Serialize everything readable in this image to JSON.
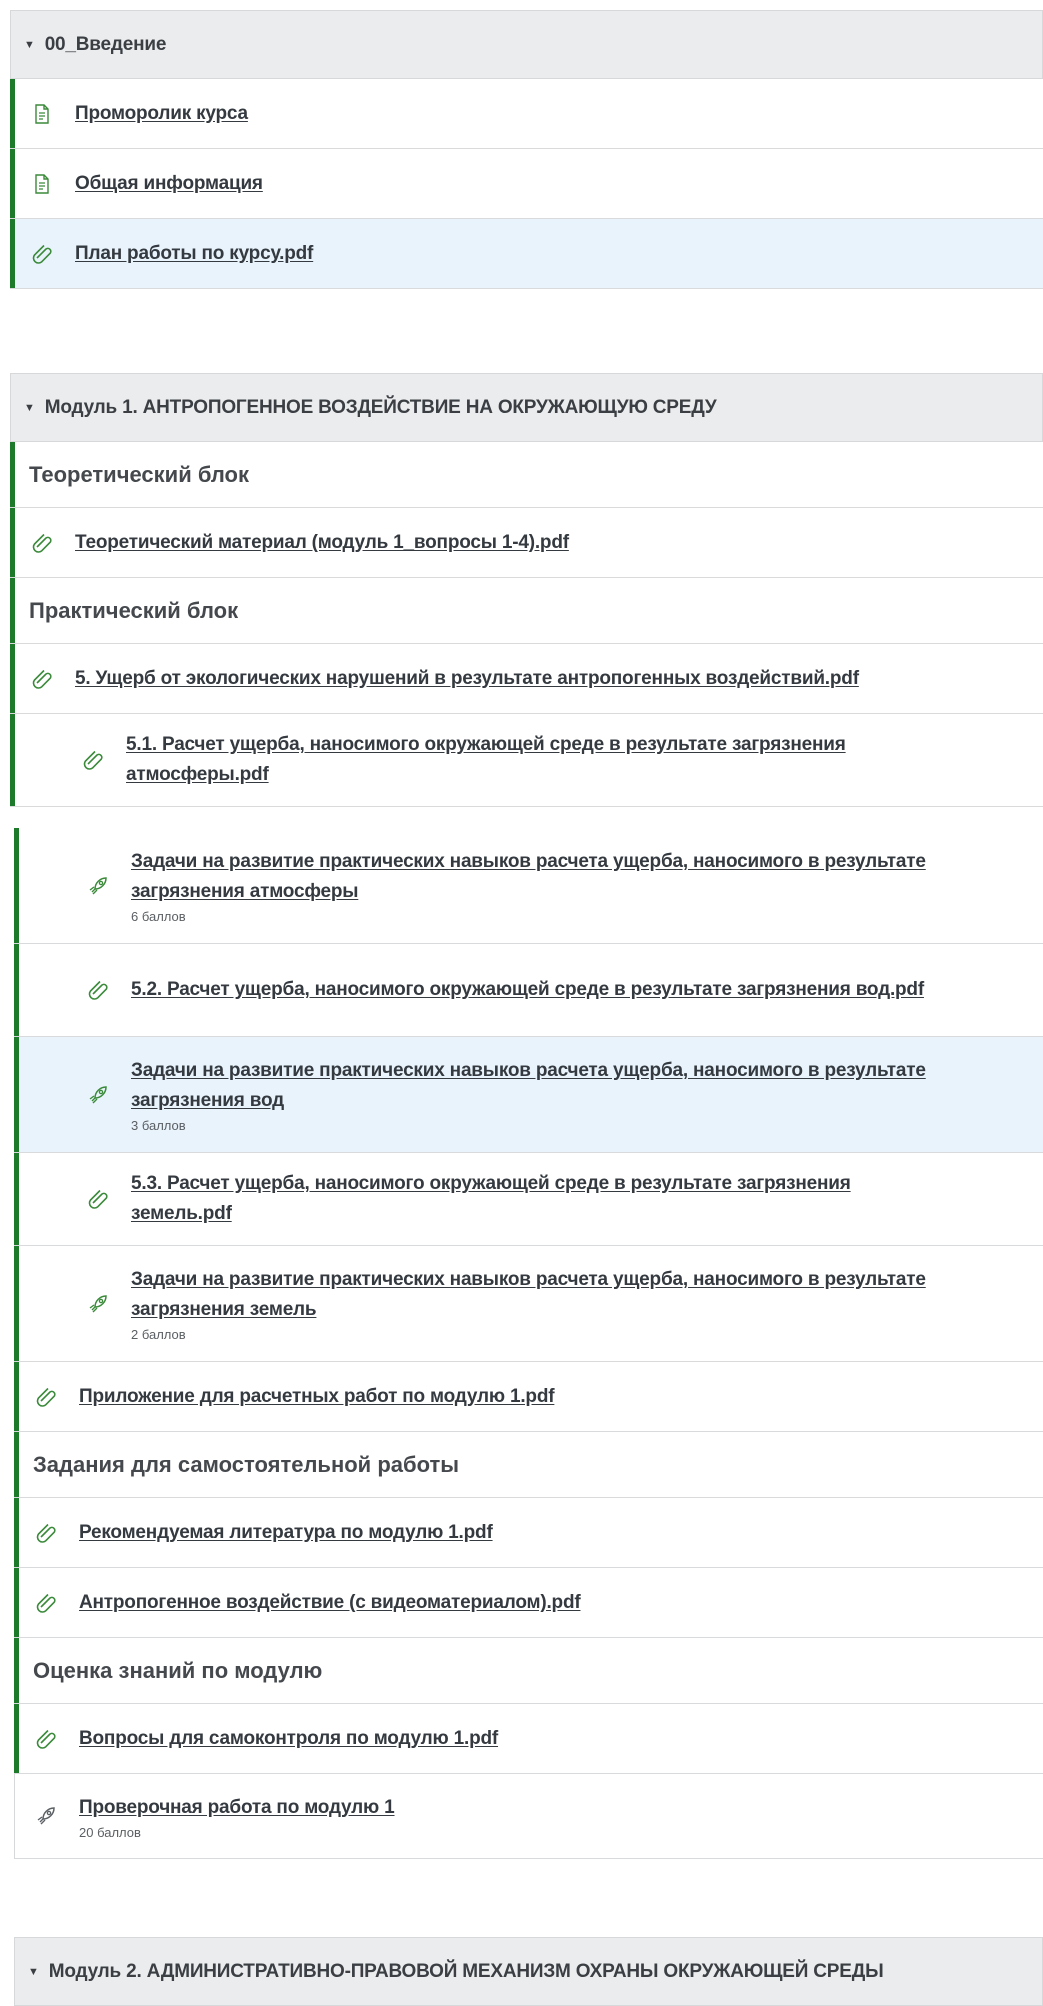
{
  "section0": {
    "title": "00_Введение",
    "items": [
      {
        "label": "Проморолик курса"
      },
      {
        "label": "Общая информация"
      },
      {
        "label": "План работы по курсу.pdf"
      }
    ]
  },
  "section1": {
    "title": "Модуль 1. АНТРОПОГЕННОЕ ВОЗДЕЙСТВИЕ НА ОКРУЖАЮЩУЮ СРЕДУ",
    "theory_label": "Теоретический блок",
    "theory_item": "Теоретический материал (модуль 1_вопросы 1-4).pdf",
    "practice_label": "Практический блок",
    "practice_item": "5. Ущерб от экологических нарушений в результате антропогенных воздействий.pdf",
    "sub1": "5.1. Расчет ущерба, наносимого окружающей среде в результате загрязнения атмосферы.pdf",
    "task1": {
      "label": "Задачи на развитие практических навыков расчета ущерба, наносимого в результате загрязнения атмосферы",
      "points": "6 баллов"
    },
    "sub2": "5.2. Расчет ущерба, наносимого окружающей среде в результате загрязнения вод.pdf",
    "task2": {
      "label": "Задачи на развитие практических навыков расчета ущерба, наносимого в результате загрязнения вод",
      "points": "3 баллов"
    },
    "sub3": "5.3. Расчет ущерба, наносимого окружающей среде в результате загрязнения земель.pdf",
    "task3": {
      "label": "Задачи на развитие практических навыков расчета ущерба, наносимого в результате загрязнения земель",
      "points": "2 баллов"
    },
    "appendix": "Приложение для расчетных работ по модулю 1.pdf",
    "selfwork_label": "Задания для самостоятельной работы",
    "lit": "Рекомендуемая литература по модулю 1.pdf",
    "video": "Антропогенное  воздействие (с видеоматериалом).pdf",
    "assess_label": "Оценка знаний по модулю",
    "questions": "Вопросы для самоконтроля по модулю 1.pdf",
    "check": {
      "label": "Проверочная работа по модулю 1",
      "points": "20 баллов"
    }
  },
  "section2": {
    "title": "Модуль 2. АДМИНИСТРАТИВНО-ПРАВОВОЙ МЕХАНИЗМ ОХРАНЫ ОКРУЖАЮЩЕЙ СРЕДЫ"
  },
  "colors": {
    "accent_bar": "#1d7a2b",
    "icon_green": "#3a8a3a",
    "highlight": "#e9f3fb"
  }
}
